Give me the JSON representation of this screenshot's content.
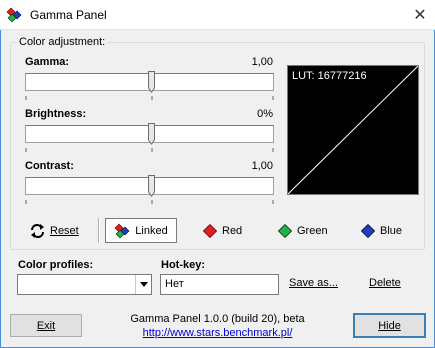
{
  "window": {
    "title": "Gamma Panel",
    "close_glyph": "✕"
  },
  "color_adjustment": {
    "group_title": "Color adjustment:",
    "sliders": [
      {
        "label": "Gamma:",
        "value_text": "1,00",
        "position": 0.5
      },
      {
        "label": "Brightness:",
        "value_text": "0%",
        "position": 0.5
      },
      {
        "label": "Contrast:",
        "value_text": "1,00",
        "position": 0.5
      }
    ],
    "lut_text": "LUT: 16777216"
  },
  "channel_buttons": {
    "reset": "Reset",
    "linked": "Linked",
    "red": "Red",
    "green": "Green",
    "blue": "Blue"
  },
  "profiles": {
    "label": "Color profiles:",
    "selected": ""
  },
  "hotkey": {
    "label": "Hot-key:",
    "value": "Нет"
  },
  "actions": {
    "save_as": "Save as...",
    "delete": "Delete",
    "exit": "Exit",
    "hide": "Hide"
  },
  "footer": {
    "version": "Gamma Panel 1.0.0 (build 20), beta",
    "url": "http://www.stars.benchmark.pl/"
  },
  "colors": {
    "accent_border": "#4a8fd9",
    "red": "#e02020",
    "green": "#22b14c",
    "blue": "#1f3fbf"
  }
}
